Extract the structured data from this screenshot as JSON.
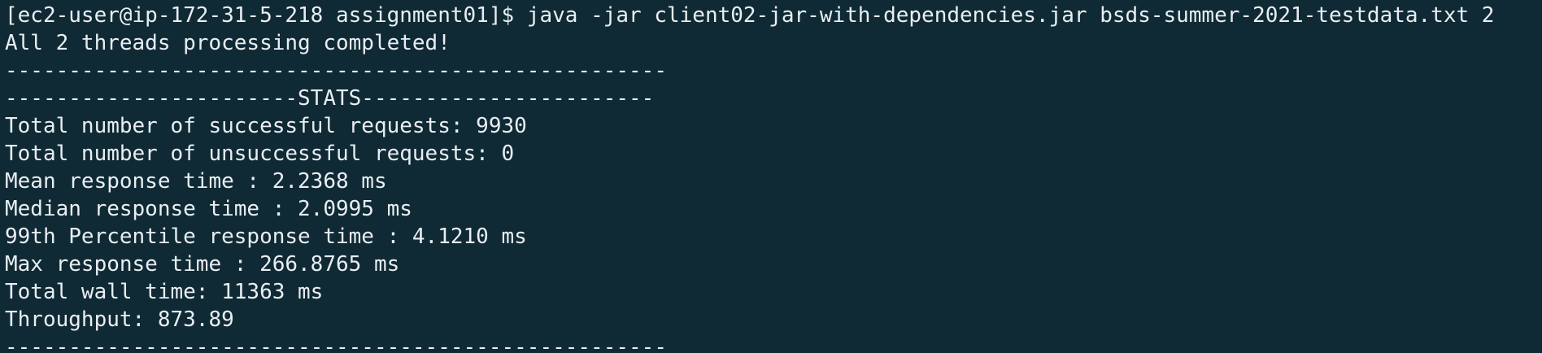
{
  "terminal": {
    "prompt": "[ec2-user@ip-172-31-5-218 assignment01]$ ",
    "command": "java -jar client02-jar-with-dependencies.jar bsds-summer-2021-testdata.txt 2",
    "lines": [
      "All 2 threads processing completed!",
      "----------------------------------------------------",
      "-----------------------STATS-----------------------",
      "Total number of successful requests: 9930",
      "Total number of unsuccessful requests: 0",
      "Mean response time : 2.2368 ms",
      "Median response time : 2.0995 ms",
      "99th Percentile response time : 4.1210 ms",
      "Max response time : 266.8765 ms",
      "Total wall time: 11363 ms",
      "Throughput: 873.89",
      "----------------------------------------------------"
    ]
  }
}
